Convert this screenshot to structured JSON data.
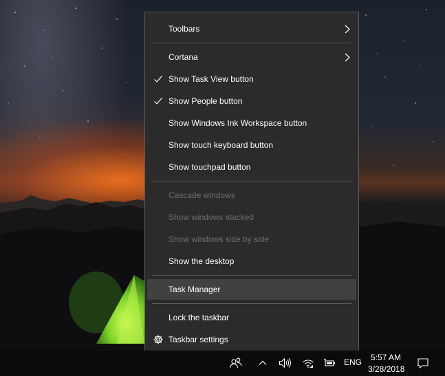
{
  "context_menu": {
    "items": [
      {
        "label": "Toolbars",
        "submenu": true
      },
      {
        "label": "Cortana",
        "submenu": true
      },
      {
        "label": "Show Task View button",
        "checked": true
      },
      {
        "label": "Show People button",
        "checked": true
      },
      {
        "label": "Show Windows Ink Workspace button"
      },
      {
        "label": "Show touch keyboard button"
      },
      {
        "label": "Show touchpad button"
      },
      {
        "label": "Cascade windows",
        "disabled": true
      },
      {
        "label": "Show windows stacked",
        "disabled": true
      },
      {
        "label": "Show windows side by side",
        "disabled": true
      },
      {
        "label": "Show the desktop"
      },
      {
        "label": "Task Manager",
        "highlighted": true
      },
      {
        "label": "Lock the taskbar"
      },
      {
        "label": "Taskbar settings",
        "icon": "gear-icon"
      }
    ]
  },
  "taskbar": {
    "tray_icons": [
      "people-icon",
      "chevron-up-icon",
      "volume-icon",
      "network-icon",
      "battery-icon"
    ],
    "language": "ENG",
    "time": "5:57 AM",
    "date": "3/28/2018",
    "notification_icon": "action-center-icon"
  },
  "colors": {
    "menu_background": "#2b2b2b",
    "menu_highlight": "#414141",
    "menu_text": "#ffffff",
    "menu_disabled_text": "#6d6d6d",
    "taskbar_background": "#0b0b0c"
  }
}
